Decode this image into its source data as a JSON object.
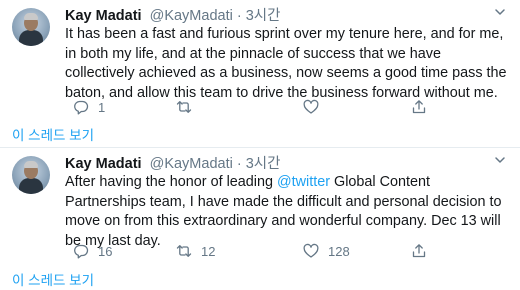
{
  "tweets": [
    {
      "name": "Kay Madati",
      "handle": "@KayMadati",
      "separator": "·",
      "time": "3시간",
      "text": "It has been a fast and furious sprint over my tenure here, and for me, in both my life, and at the pinnacle of success that we have collectively achieved as a business, now seems a good time pass the baton, and allow this team to drive the business forward without me.",
      "reply_count": "1",
      "retweet_count": "",
      "like_count": "",
      "thread_link": "이 스레드 보기"
    },
    {
      "name": "Kay Madati",
      "handle": "@KayMadati",
      "separator": "·",
      "time": "3시간",
      "text_before": "After having the honor of leading ",
      "mention": "@twitter",
      "text_after": " Global Content Partnerships team, I have made the difficult and personal decision to move on from this extraordinary and wonderful company. Dec 13 will be my last day.",
      "reply_count": "16",
      "retweet_count": "12",
      "like_count": "128",
      "thread_link": "이 스레드 보기"
    }
  ],
  "icons": {
    "reply": "reply-icon",
    "retweet": "retweet-icon",
    "like": "heart-icon",
    "share": "share-icon",
    "more": "chevron-down-icon"
  },
  "colors": {
    "accent": "#1da1f2",
    "secondary_text": "#657786",
    "divider": "#e6ecf0"
  }
}
